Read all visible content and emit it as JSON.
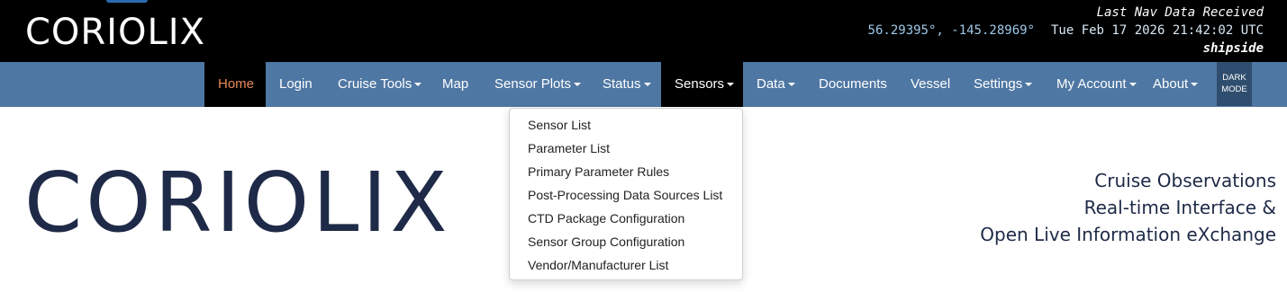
{
  "header": {
    "brand": "CORIOLIX",
    "nav_info": {
      "title": "Last Nav Data Received",
      "coordinates": "56.29395°, -145.28969°",
      "timestamp": "Tue Feb 17 2026 21:42:02 UTC",
      "mode": "shipside"
    }
  },
  "navbar": {
    "items": [
      {
        "label": "Home"
      },
      {
        "label": "Login"
      },
      {
        "label": "Cruise Tools"
      },
      {
        "label": "Map"
      },
      {
        "label": "Sensor Plots"
      },
      {
        "label": "Status"
      },
      {
        "label": "Sensors"
      },
      {
        "label": "Data"
      },
      {
        "label": "Documents"
      },
      {
        "label": "Vessel"
      },
      {
        "label": "Settings"
      },
      {
        "label": "My Account"
      },
      {
        "label": "About"
      }
    ],
    "dark_mode": {
      "line1": "DARK",
      "line2": "MODE"
    }
  },
  "sensors_dropdown": {
    "items": [
      "Sensor List",
      "Parameter List",
      "Primary Parameter Rules",
      "Post-Processing Data Sources List",
      "CTD Package Configuration",
      "Sensor Group Configuration",
      "Vendor/Manufacturer List"
    ]
  },
  "hero": {
    "logo": "CORIOLIX",
    "tagline": [
      "Cruise Observations",
      "Real-time Interface &",
      "Open Live Information eXchange"
    ]
  },
  "colors": {
    "topbar": "#000000",
    "navbar": "#4f77a3",
    "home_text": "#e88a5a",
    "hero_text": "#1e2a47"
  }
}
